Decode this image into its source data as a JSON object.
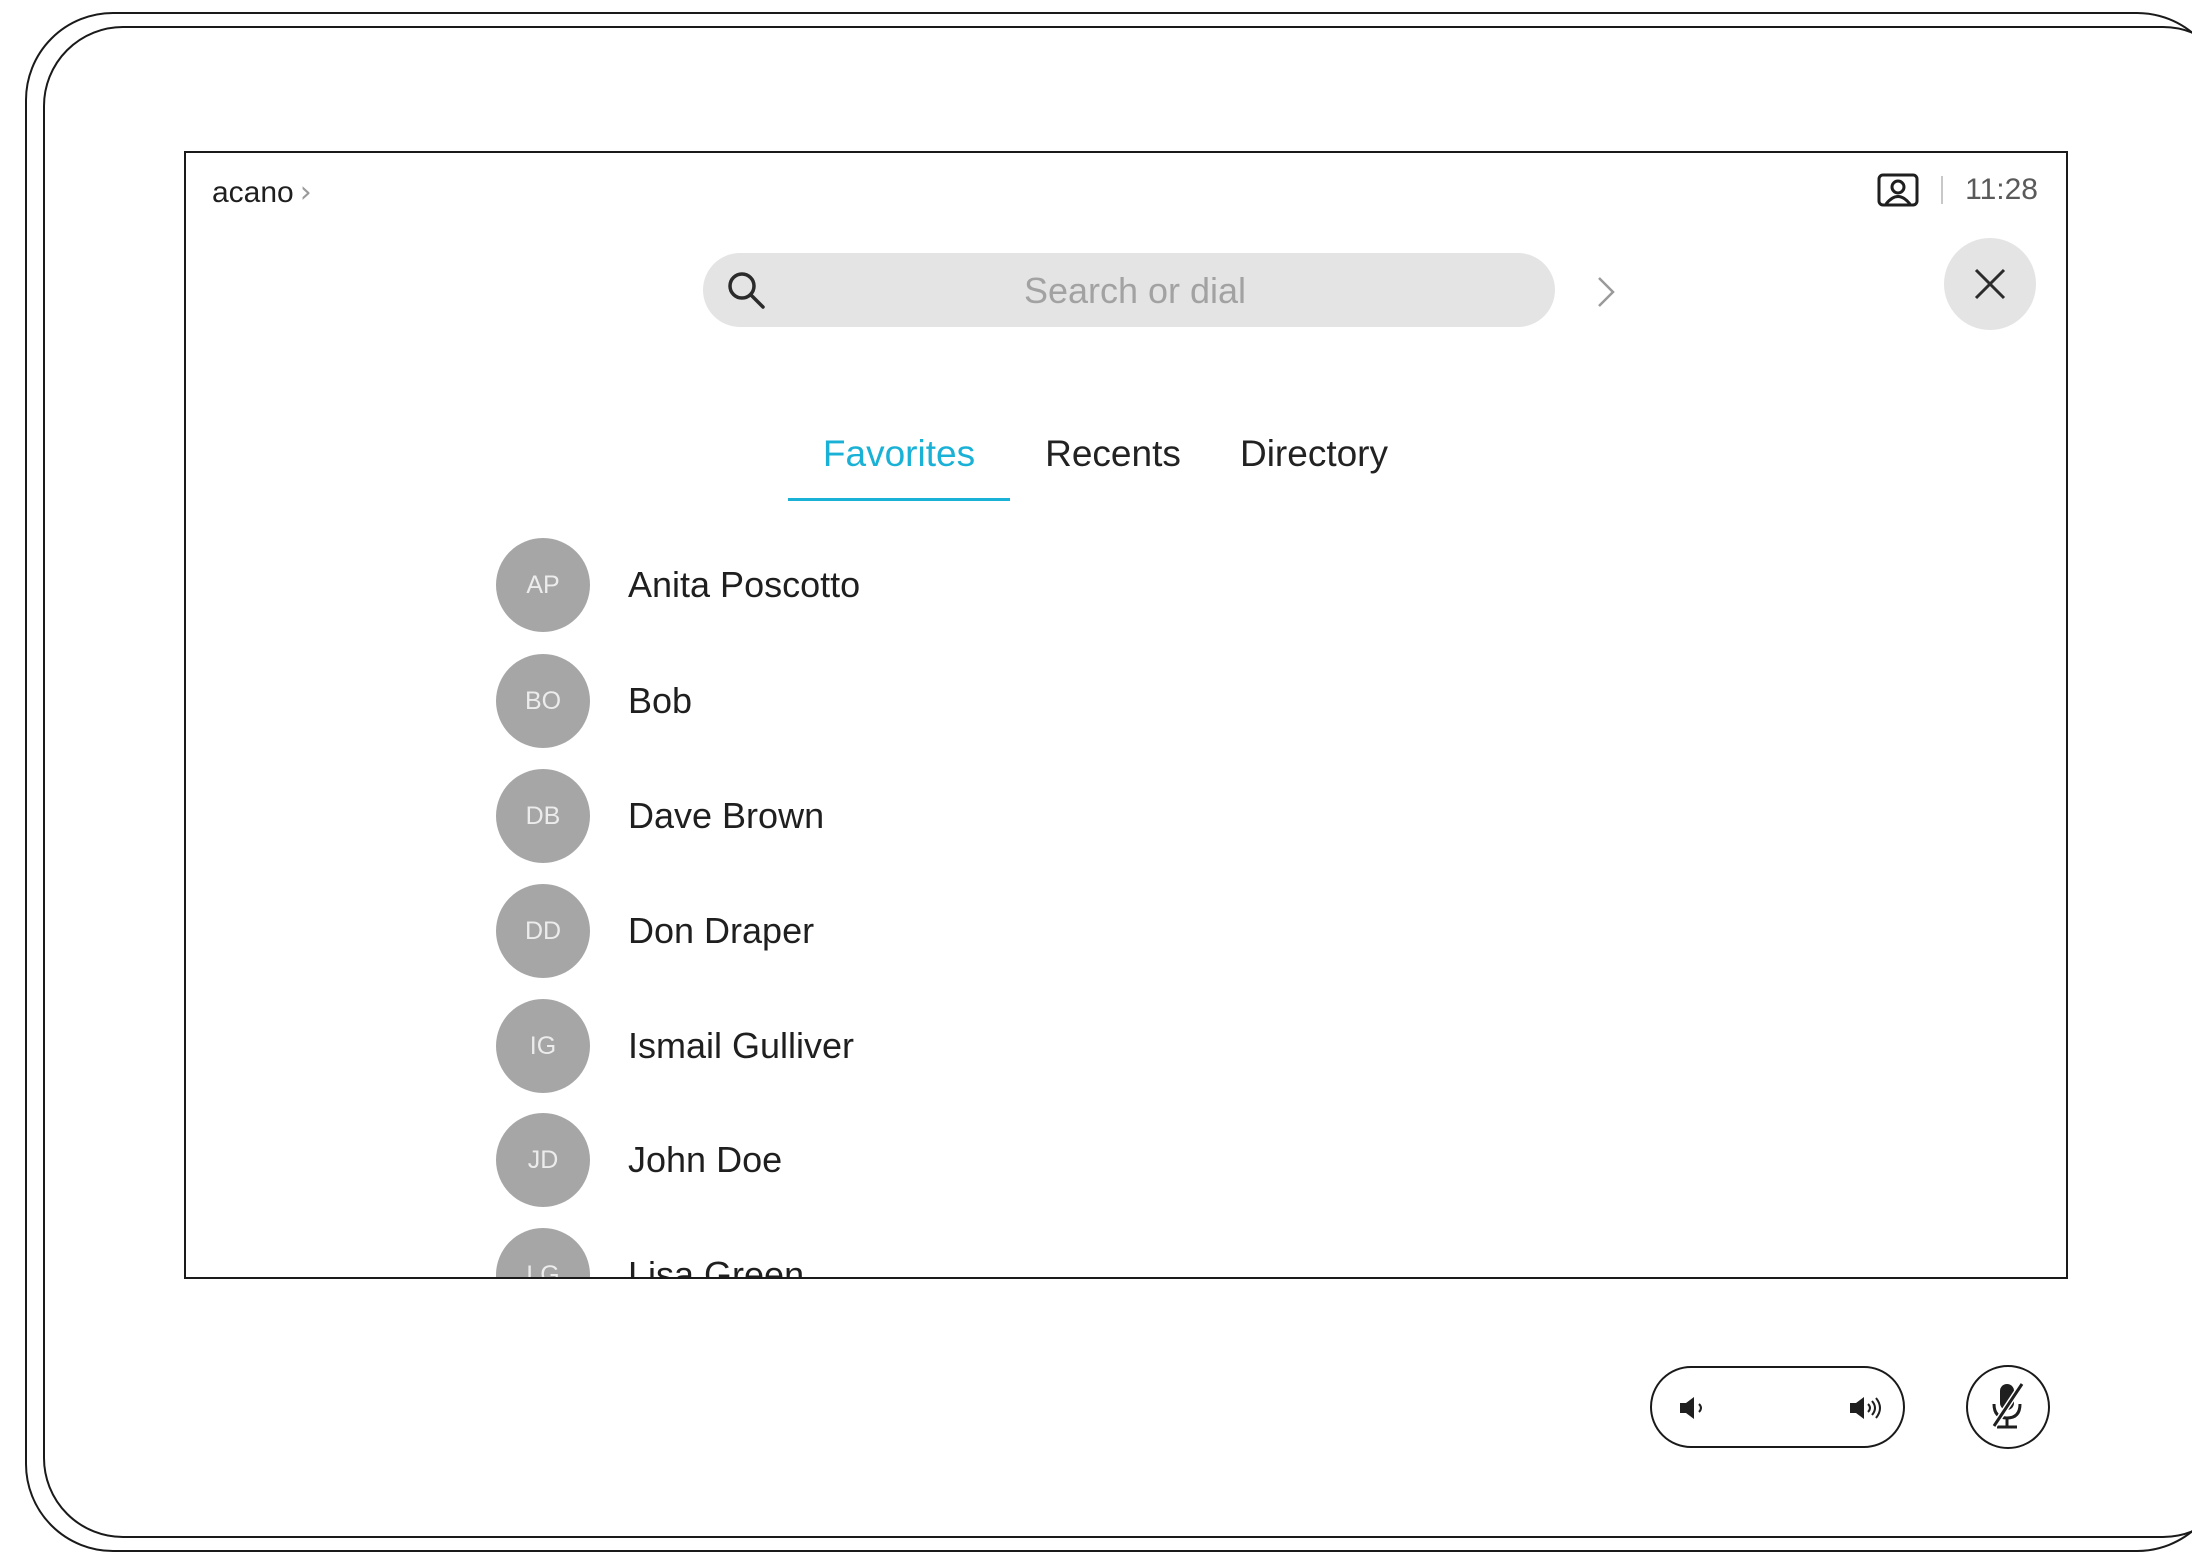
{
  "topbar": {
    "system_name": "acano",
    "time": "11:28"
  },
  "search": {
    "placeholder": "Search or dial"
  },
  "tabs": [
    {
      "label": "Favorites",
      "active": true
    },
    {
      "label": "Recents",
      "active": false
    },
    {
      "label": "Directory",
      "active": false
    }
  ],
  "contacts": [
    {
      "initials": "AP",
      "name": "Anita Poscotto"
    },
    {
      "initials": "BO",
      "name": "Bob"
    },
    {
      "initials": "DB",
      "name": "Dave Brown"
    },
    {
      "initials": "DD",
      "name": "Don Draper"
    },
    {
      "initials": "IG",
      "name": "Ismail Gulliver"
    },
    {
      "initials": "JD",
      "name": "John Doe"
    },
    {
      "initials": "LG",
      "name": "Lisa Green"
    }
  ],
  "colors": {
    "accent": "#1ab1d6",
    "avatar_bg": "#a6a6a6",
    "search_bg": "#e4e4e4"
  },
  "icons": {
    "selfview": "selfview-icon",
    "search": "search-icon",
    "close": "close-icon",
    "volume_down": "volume-down-icon",
    "volume_up": "volume-up-icon",
    "mute": "microphone-muted-icon"
  }
}
